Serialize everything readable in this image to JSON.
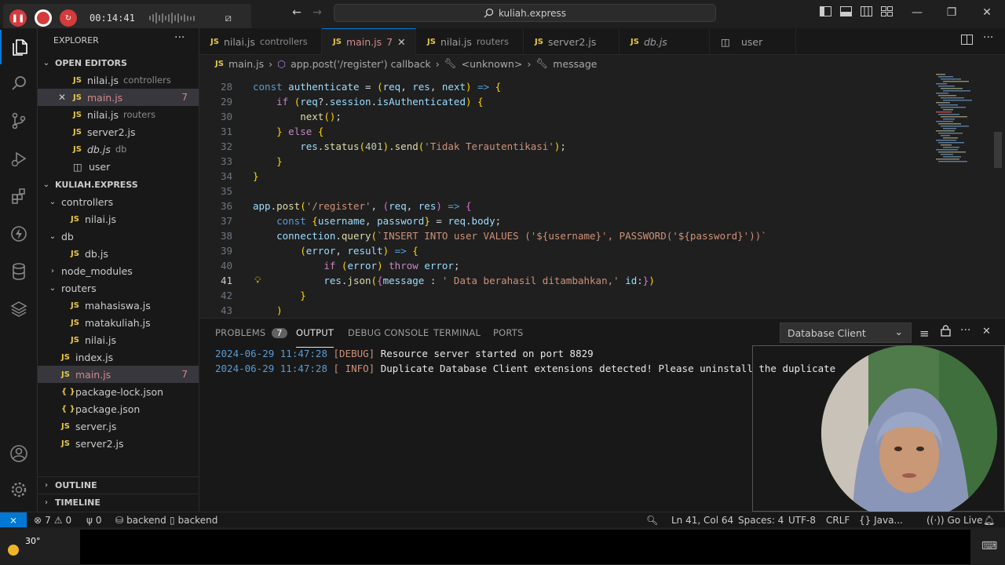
{
  "recorder": {
    "time": "00:14:41"
  },
  "titlebar": {
    "search": "kuliah.express"
  },
  "explorer": {
    "title": "EXPLORER",
    "open_editors_label": "OPEN EDITORS",
    "open_editors": [
      {
        "name": "nilai.js",
        "desc": "controllers",
        "type": "js"
      },
      {
        "name": "main.js",
        "desc": "",
        "type": "js",
        "badge": "7",
        "active": true,
        "close": "✕"
      },
      {
        "name": "nilai.js",
        "desc": "routers",
        "type": "js"
      },
      {
        "name": "server2.js",
        "desc": "",
        "type": "js"
      },
      {
        "name": "db.js",
        "desc": "db",
        "type": "js"
      },
      {
        "name": "user",
        "desc": "",
        "type": "table"
      }
    ],
    "project_label": "KULIAH.EXPRESS",
    "tree": [
      {
        "name": "controllers",
        "kind": "folder-open",
        "indent": 1
      },
      {
        "name": "nilai.js",
        "kind": "js",
        "indent": 2
      },
      {
        "name": "db",
        "kind": "folder-open",
        "indent": 1
      },
      {
        "name": "db.js",
        "kind": "js",
        "indent": 2
      },
      {
        "name": "node_modules",
        "kind": "folder-closed",
        "indent": 1
      },
      {
        "name": "routers",
        "kind": "folder-open",
        "indent": 1
      },
      {
        "name": "mahasiswa.js",
        "kind": "js",
        "indent": 2
      },
      {
        "name": "matakuliah.js",
        "kind": "js",
        "indent": 2
      },
      {
        "name": "nilai.js",
        "kind": "js",
        "indent": 2
      },
      {
        "name": "index.js",
        "kind": "js",
        "indent": 1
      },
      {
        "name": "main.js",
        "kind": "js",
        "indent": 1,
        "badge": "7",
        "active": true
      },
      {
        "name": "package-lock.json",
        "kind": "json",
        "indent": 1
      },
      {
        "name": "package.json",
        "kind": "json",
        "indent": 1
      },
      {
        "name": "server.js",
        "kind": "js",
        "indent": 1
      },
      {
        "name": "server2.js",
        "kind": "js",
        "indent": 1
      }
    ],
    "outline_label": "OUTLINE",
    "timeline_label": "TIMELINE"
  },
  "tabs": [
    {
      "name": "nilai.js",
      "desc": "controllers",
      "type": "js"
    },
    {
      "name": "main.js",
      "desc": "",
      "badge": "7",
      "type": "js",
      "active": true
    },
    {
      "name": "nilai.js",
      "desc": "routers",
      "type": "js"
    },
    {
      "name": "server2.js",
      "desc": "",
      "type": "js"
    },
    {
      "name": "db.js",
      "desc": "",
      "type": "js"
    },
    {
      "name": "user",
      "desc": "",
      "type": "table"
    }
  ],
  "breadcrumb": {
    "file": "main.js",
    "symbol1": "app.post('/register') callback",
    "symbol2": "<unknown>",
    "symbol3": "message"
  },
  "editor": {
    "current_line": "41",
    "lines": [
      {
        "n": "28",
        "code": "const authenticate = (req, res, next) => {"
      },
      {
        "n": "29",
        "code": "    if (req?.session.isAuthenticated) {"
      },
      {
        "n": "30",
        "code": "        next();"
      },
      {
        "n": "31",
        "code": "    } else {"
      },
      {
        "n": "32",
        "code": "        res.status(401).send('Tidak Terautentikasi');"
      },
      {
        "n": "33",
        "code": "    }"
      },
      {
        "n": "34",
        "code": "}"
      },
      {
        "n": "35",
        "code": ""
      },
      {
        "n": "36",
        "code": "app.post('/register', (req, res) => {"
      },
      {
        "n": "37",
        "code": "    const {username, password} = req.body;"
      },
      {
        "n": "38",
        "code": "    connection.query(`INSERT INTO user VALUES ('${username}', PASSWORD('${password}'))`"
      },
      {
        "n": "39",
        "code": "        (error, result) => {"
      },
      {
        "n": "40",
        "code": "            if (error) throw error;"
      },
      {
        "n": "41",
        "code": "            res.json({message : ' Data berahasil ditambahkan,' id:})"
      },
      {
        "n": "42",
        "code": "        }"
      },
      {
        "n": "43",
        "code": "    )"
      }
    ]
  },
  "panel": {
    "tabs": [
      "PROBLEMS",
      "OUTPUT",
      "DEBUG CONSOLE",
      "TERMINAL",
      "PORTS"
    ],
    "problems_count": "7",
    "active_tab": "OUTPUT",
    "channel": "Database Client",
    "output": [
      {
        "ts": "2024-06-29 11:47:28",
        "level": "[DEBUG]",
        "msg": "Resource server started on port 8829"
      },
      {
        "ts": "2024-06-29 11:47:28",
        "level": "[ INFO]",
        "msg": "Duplicate Database Client extensions detected! Please uninstall the duplicate"
      }
    ]
  },
  "statusbar": {
    "errors": "7",
    "warnings": "0",
    "ports": "0",
    "branch1": "backend",
    "branch2": "backend",
    "position": "Ln 41, Col 64",
    "spaces": "Spaces: 4",
    "encoding": "UTF-8",
    "eol": "CRLF",
    "language": "{} Java...",
    "golive": "Go Live"
  },
  "taskbar": {
    "weather": "30°"
  },
  "colors": {
    "accent": "#0078d4",
    "js_icon": "#e8c64a",
    "error_badge": "#d4898c"
  }
}
